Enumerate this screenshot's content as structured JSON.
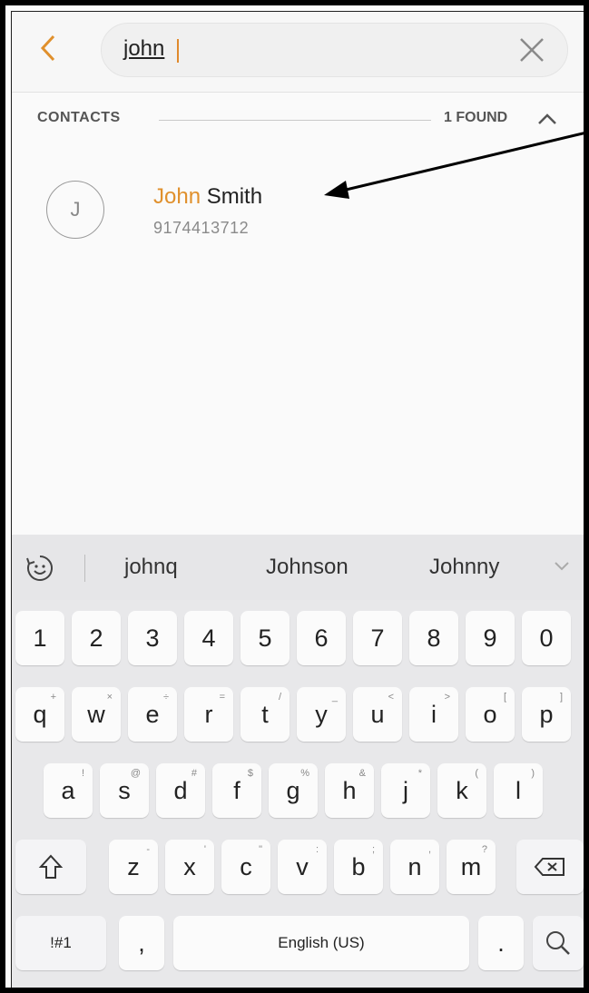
{
  "search": {
    "query": "john"
  },
  "results": {
    "section_title": "CONTACTS",
    "count_label": "1 FOUND",
    "contact": {
      "avatar_initial": "J",
      "name_match": "John",
      "name_rest": " Smith",
      "number": "9174413712"
    }
  },
  "keyboard": {
    "suggestions": [
      "johnq",
      "Johnson",
      "Johnny"
    ],
    "number_row": [
      "1",
      "2",
      "3",
      "4",
      "5",
      "6",
      "7",
      "8",
      "9",
      "0"
    ],
    "row_q": [
      {
        "k": "q",
        "h": "+"
      },
      {
        "k": "w",
        "h": "×"
      },
      {
        "k": "e",
        "h": "÷"
      },
      {
        "k": "r",
        "h": "="
      },
      {
        "k": "t",
        "h": "/"
      },
      {
        "k": "y",
        "h": "_"
      },
      {
        "k": "u",
        "h": "<"
      },
      {
        "k": "i",
        "h": ">"
      },
      {
        "k": "o",
        "h": "["
      },
      {
        "k": "p",
        "h": "]"
      }
    ],
    "row_a": [
      {
        "k": "a",
        "h": "!"
      },
      {
        "k": "s",
        "h": "@"
      },
      {
        "k": "d",
        "h": "#"
      },
      {
        "k": "f",
        "h": "$"
      },
      {
        "k": "g",
        "h": "%"
      },
      {
        "k": "h",
        "h": "&"
      },
      {
        "k": "j",
        "h": "*"
      },
      {
        "k": "k",
        "h": "("
      },
      {
        "k": "l",
        "h": ")"
      }
    ],
    "row_z": [
      {
        "k": "z",
        "h": "-"
      },
      {
        "k": "x",
        "h": "'"
      },
      {
        "k": "c",
        "h": "\""
      },
      {
        "k": "v",
        "h": ":"
      },
      {
        "k": "b",
        "h": ";"
      },
      {
        "k": "n",
        "h": ","
      },
      {
        "k": "m",
        "h": "?"
      }
    ],
    "symbols_label": "!#1",
    "comma_label": ",",
    "space_label": "English (US)",
    "period_label": "."
  },
  "accent_color": "#e0902c"
}
